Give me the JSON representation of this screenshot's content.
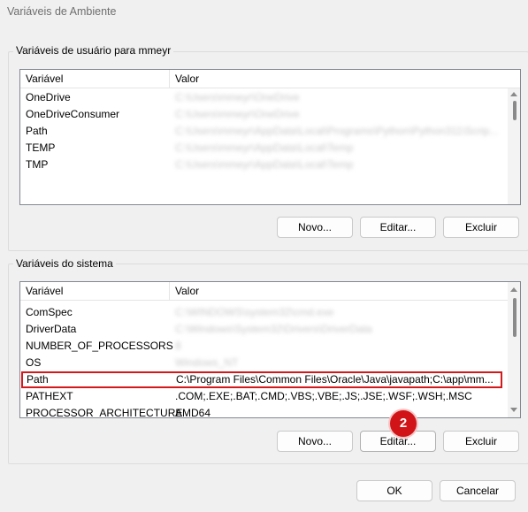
{
  "window": {
    "title": "Variáveis de Ambiente"
  },
  "user_group": {
    "label": "Variáveis de usuário para mmeyr",
    "columns": [
      "Variável",
      "Valor"
    ],
    "rows": [
      {
        "name": "OneDrive",
        "value": "C:\\Users\\mmeyr\\OneDrive",
        "obscured": true
      },
      {
        "name": "OneDriveConsumer",
        "value": "C:\\Users\\mmeyr\\OneDrive",
        "obscured": true
      },
      {
        "name": "Path",
        "value": "C:\\Users\\mmeyr\\AppData\\Local\\Programs\\Python\\Python311\\Scrip...",
        "obscured": true
      },
      {
        "name": "TEMP",
        "value": "C:\\Users\\mmeyr\\AppData\\Local\\Temp",
        "obscured": true
      },
      {
        "name": "TMP",
        "value": "C:\\Users\\mmeyr\\AppData\\Local\\Temp",
        "obscured": true
      }
    ],
    "buttons": {
      "new": "Novo...",
      "edit": "Editar...",
      "delete": "Excluir"
    }
  },
  "system_group": {
    "label": "Variáveis do sistema",
    "columns": [
      "Variável",
      "Valor"
    ],
    "rows": [
      {
        "name": "ComSpec",
        "value": "C:\\WINDOWS\\system32\\cmd.exe",
        "obscured": true
      },
      {
        "name": "DriverData",
        "value": "C:\\Windows\\System32\\Drivers\\DriverData",
        "obscured": true
      },
      {
        "name": "NUMBER_OF_PROCESSORS",
        "value": "8",
        "obscured": true
      },
      {
        "name": "OS",
        "value": "Windows_NT",
        "obscured": true
      },
      {
        "name": "Path",
        "value": "C:\\Program Files\\Common Files\\Oracle\\Java\\javapath;C:\\app\\mm...",
        "obscured": false,
        "selected": true
      },
      {
        "name": "PATHEXT",
        "value": ".COM;.EXE;.BAT;.CMD;.VBS;.VBE;.JS;.JSE;.WSF;.WSH;.MSC",
        "obscured": false
      },
      {
        "name": "PROCESSOR_ARCHITECTURE",
        "value": "AMD64",
        "obscured": false
      }
    ],
    "buttons": {
      "new": "Novo...",
      "edit": "Editar...",
      "delete": "Excluir"
    }
  },
  "step_badge": "2",
  "footer": {
    "ok": "OK",
    "cancel": "Cancelar"
  },
  "colors": {
    "highlight": "#d3191c",
    "badge": "#d01417"
  }
}
